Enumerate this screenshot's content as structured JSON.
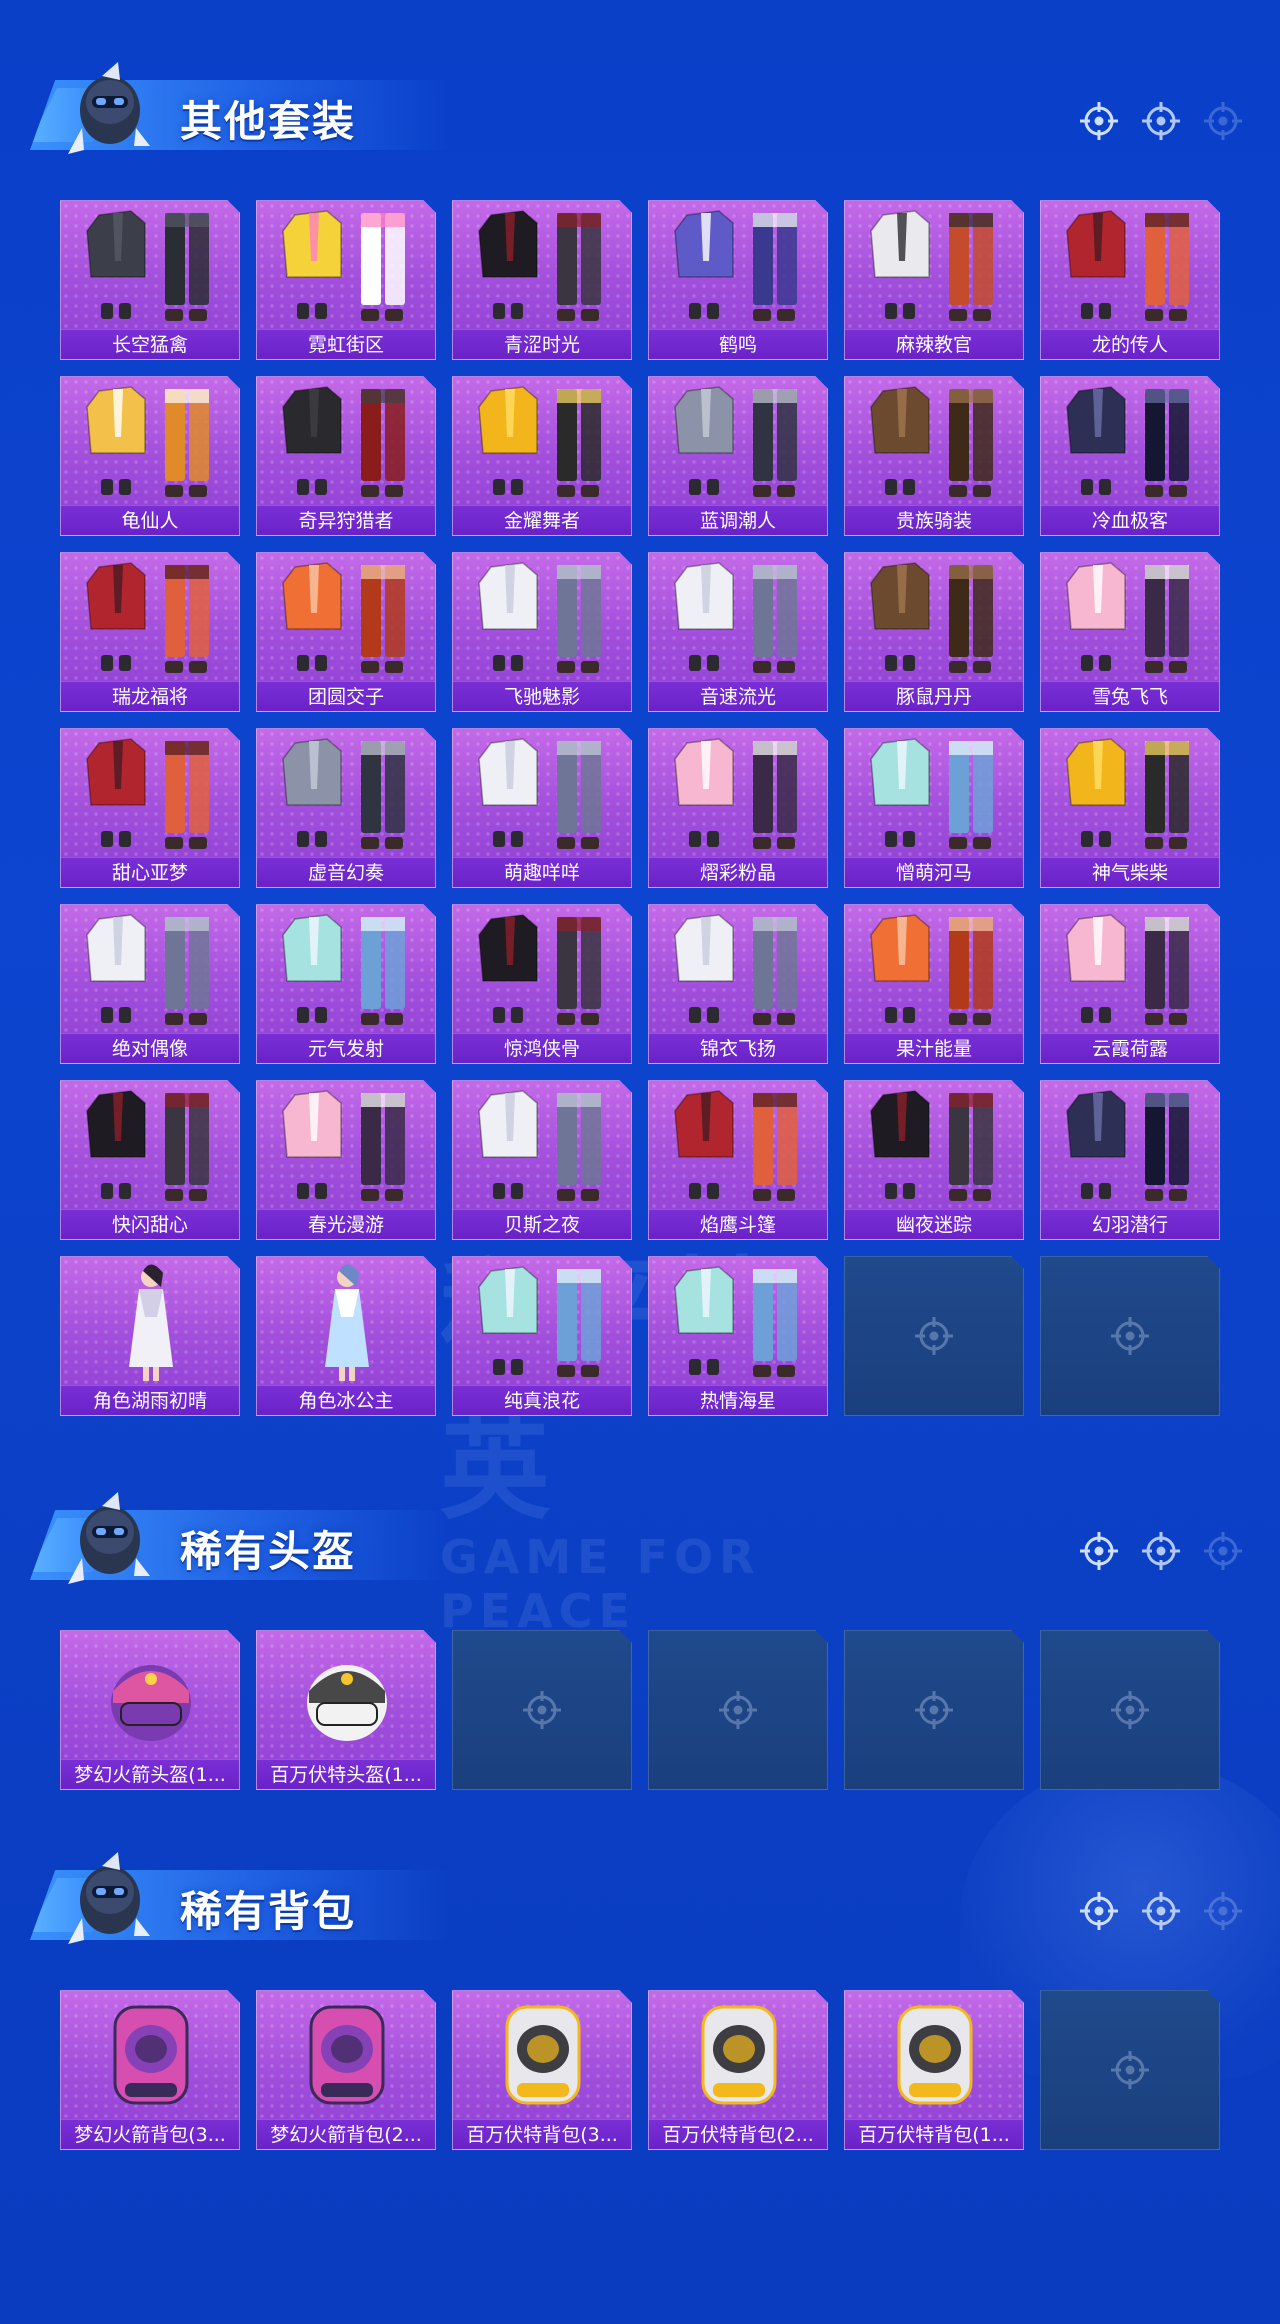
{
  "sections": [
    {
      "id": "outfits",
      "title": "其他套装",
      "items": [
        {
          "name": "长空猛禽",
          "kind": "jacket-dark"
        },
        {
          "name": "霓虹街区",
          "kind": "outfit-yellow"
        },
        {
          "name": "青涩时光",
          "kind": "outfit-black"
        },
        {
          "name": "鹤鸣",
          "kind": "hoodie-purple"
        },
        {
          "name": "麻辣教官",
          "kind": "outfit-stripe"
        },
        {
          "name": "龙的传人",
          "kind": "outfit-red"
        },
        {
          "name": "龟仙人",
          "kind": "shirt-yellow"
        },
        {
          "name": "奇异狩猎者",
          "kind": "coat-hood"
        },
        {
          "name": "金耀舞者",
          "kind": "outfit-gold"
        },
        {
          "name": "蓝调潮人",
          "kind": "outfit-grey"
        },
        {
          "name": "贵族骑装",
          "kind": "outfit-brown"
        },
        {
          "name": "冷血极客",
          "kind": "outfit-navy"
        },
        {
          "name": "瑞龙福将",
          "kind": "outfit-red"
        },
        {
          "name": "团圆交子",
          "kind": "outfit-orange"
        },
        {
          "name": "飞驰魅影",
          "kind": "outfit-white"
        },
        {
          "name": "音速流光",
          "kind": "outfit-white"
        },
        {
          "name": "豚鼠丹丹",
          "kind": "outfit-brown"
        },
        {
          "name": "雪兔飞飞",
          "kind": "outfit-pink"
        },
        {
          "name": "甜心亚梦",
          "kind": "outfit-red"
        },
        {
          "name": "虚音幻奏",
          "kind": "outfit-grey"
        },
        {
          "name": "萌趣咩咩",
          "kind": "outfit-white"
        },
        {
          "name": "熠彩粉晶",
          "kind": "outfit-pink"
        },
        {
          "name": "憎萌河马",
          "kind": "outfit-mint"
        },
        {
          "name": "神气柴柴",
          "kind": "outfit-gold"
        },
        {
          "name": "绝对偶像",
          "kind": "outfit-white"
        },
        {
          "name": "元气发射",
          "kind": "outfit-mint"
        },
        {
          "name": "惊鸿侠骨",
          "kind": "outfit-black"
        },
        {
          "name": "锦衣飞扬",
          "kind": "outfit-white"
        },
        {
          "name": "果汁能量",
          "kind": "outfit-orange"
        },
        {
          "name": "云霞荷露",
          "kind": "outfit-pink"
        },
        {
          "name": "快闪甜心",
          "kind": "outfit-black"
        },
        {
          "name": "春光漫游",
          "kind": "outfit-pink"
        },
        {
          "name": "贝斯之夜",
          "kind": "outfit-white"
        },
        {
          "name": "焰鹰斗篷",
          "kind": "outfit-red"
        },
        {
          "name": "幽夜迷踪",
          "kind": "outfit-black"
        },
        {
          "name": "幻羽潜行",
          "kind": "outfit-navy"
        },
        {
          "name": "角色湖雨初晴",
          "kind": "figure-white"
        },
        {
          "name": "角色冰公主",
          "kind": "figure-blue"
        },
        {
          "name": "纯真浪花",
          "kind": "outfit-mint"
        },
        {
          "name": "热情海星",
          "kind": "outfit-mint"
        },
        {
          "name": "",
          "kind": "empty"
        },
        {
          "name": "",
          "kind": "empty"
        }
      ]
    },
    {
      "id": "helmets",
      "title": "稀有头盔",
      "items": [
        {
          "name": "梦幻火箭头盔(1...",
          "kind": "helmet-pink"
        },
        {
          "name": "百万伏特头盔(1...",
          "kind": "helmet-white"
        },
        {
          "name": "",
          "kind": "empty"
        },
        {
          "name": "",
          "kind": "empty"
        },
        {
          "name": "",
          "kind": "empty"
        },
        {
          "name": "",
          "kind": "empty"
        }
      ]
    },
    {
      "id": "backpacks",
      "title": "稀有背包",
      "items": [
        {
          "name": "梦幻火箭背包(3...",
          "kind": "bag-pink"
        },
        {
          "name": "梦幻火箭背包(2...",
          "kind": "bag-pink"
        },
        {
          "name": "百万伏特背包(3...",
          "kind": "bag-white"
        },
        {
          "name": "百万伏特背包(2...",
          "kind": "bag-white"
        },
        {
          "name": "百万伏特背包(1...",
          "kind": "bag-white"
        },
        {
          "name": "",
          "kind": "empty"
        }
      ]
    }
  ],
  "background_watermark": {
    "line1": "和平精英",
    "line2": "GAME FOR PEACE"
  },
  "colors": {
    "tile_top": "#c46ae8",
    "tile_bottom": "#8e3fd4",
    "label_bar": "#6a22c8",
    "empty_tile": "#1d4585",
    "page_bg": "#0b40c8"
  }
}
